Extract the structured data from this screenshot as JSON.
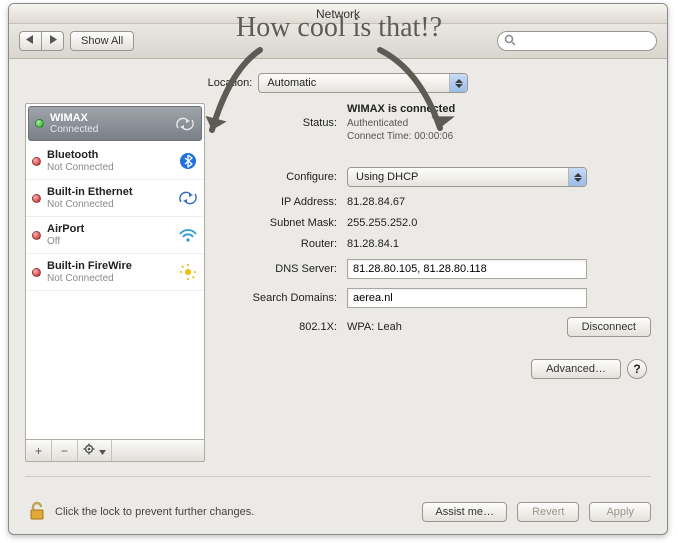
{
  "window": {
    "title": "Network",
    "show_all": "Show All",
    "search_placeholder": ""
  },
  "location": {
    "label": "Location:",
    "value": "Automatic"
  },
  "sidebar": {
    "items": [
      {
        "name": "WIMAX",
        "sub": "Connected",
        "status_color": "#1aa21a",
        "icon": "sync"
      },
      {
        "name": "Bluetooth",
        "sub": "Not Connected",
        "status_color": "#c22020",
        "icon": "bluetooth"
      },
      {
        "name": "Built-in Ethernet",
        "sub": "Not Connected",
        "status_color": "#c22020",
        "icon": "ethernet"
      },
      {
        "name": "AirPort",
        "sub": "Off",
        "status_color": "#c22020",
        "icon": "wifi"
      },
      {
        "name": "Built-in FireWire",
        "sub": "Not Connected",
        "status_color": "#c22020",
        "icon": "firewire"
      }
    ],
    "footer": {
      "add": "+",
      "remove": "−",
      "gear": "gear-icon"
    }
  },
  "details": {
    "status_label": "Status:",
    "status_value": "WIMAX is connected",
    "status_sub1": "Authenticated",
    "status_sub2": "Connect Time: 00:00:06",
    "configure_label": "Configure:",
    "configure_value": "Using DHCP",
    "ip_label": "IP Address:",
    "ip_value": "81.28.84.67",
    "mask_label": "Subnet Mask:",
    "mask_value": "255.255.252.0",
    "router_label": "Router:",
    "router_value": "81.28.84.1",
    "dns_label": "DNS Server:",
    "dns_value": "81.28.80.105, 81.28.80.118",
    "search_label": "Search Domains:",
    "search_value": "aerea.nl",
    "dot1x_label": "802.1X:",
    "dot1x_value": "WPA: Leah",
    "disconnect": "Disconnect",
    "advanced": "Advanced…",
    "help": "?"
  },
  "footer": {
    "lock_text": "Click the lock to prevent further changes.",
    "assist": "Assist me…",
    "revert": "Revert",
    "apply": "Apply"
  },
  "annotation": {
    "text": "How cool is that!?"
  }
}
